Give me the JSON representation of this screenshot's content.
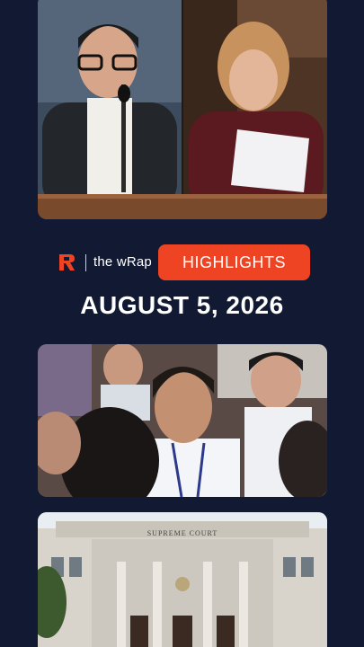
{
  "brand": {
    "show_name": "the wRap",
    "badge_label": "HIGHLIGHTS",
    "accent_color": "#ef4423",
    "logo_icon": "rappler-logo-icon"
  },
  "date": "AUGUST 5, 2026",
  "background_color": "#121a33",
  "photos": [
    {
      "name": "senate-hearing-photo",
      "subject": "two officials speaking at a hearing"
    },
    {
      "name": "crowd-photo",
      "subject": "group of people with IDs in a hall"
    },
    {
      "name": "supreme-court-photo",
      "sign_text": "SUPREME COURT"
    }
  ]
}
